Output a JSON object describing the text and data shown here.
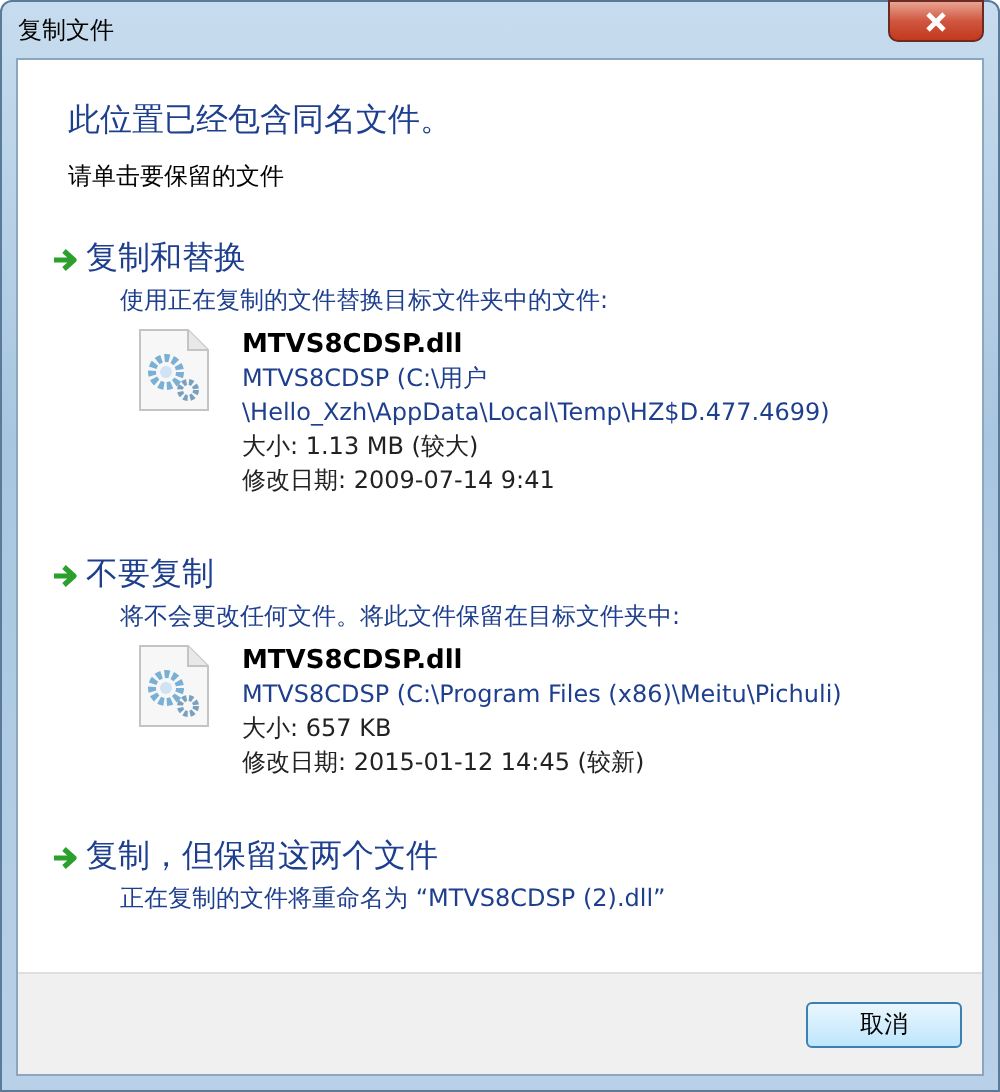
{
  "window": {
    "title": "复制文件"
  },
  "heading": "此位置已经包含同名文件。",
  "instruction": "请单击要保留的文件",
  "options": [
    {
      "title": "复制和替换",
      "description": "使用正在复制的文件替换目标文件夹中的文件:",
      "file": {
        "name": "MTVS8CDSP.dll",
        "location_lines": [
          "MTVS8CDSP (C:\\用户",
          "\\Hello_Xzh\\AppData\\Local\\Temp\\HZ$D.477.4699)"
        ],
        "size": "大小: 1.13 MB (较大)",
        "modified": "修改日期: 2009-07-14 9:41"
      }
    },
    {
      "title": "不要复制",
      "description": "将不会更改任何文件。将此文件保留在目标文件夹中:",
      "file": {
        "name": "MTVS8CDSP.dll",
        "location_lines": [
          "MTVS8CDSP (C:\\Program Files (x86)\\Meitu\\Pichuli)"
        ],
        "size": "大小: 657 KB",
        "modified": "修改日期: 2015-01-12 14:45 (较新)"
      }
    },
    {
      "title": "复制，但保留这两个文件",
      "description": "正在复制的文件将重命名为 “MTVS8CDSP (2).dll”"
    }
  ],
  "buttons": [
    "取消"
  ]
}
